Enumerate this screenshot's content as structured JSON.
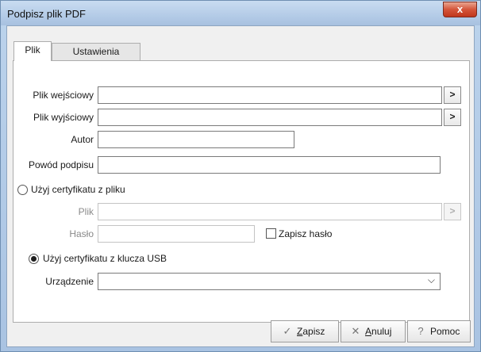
{
  "window": {
    "title": "Podpisz plik PDF",
    "close_symbol": "x"
  },
  "tabs": [
    {
      "label": "Plik",
      "active": true
    },
    {
      "label": "Ustawienia",
      "active": false
    }
  ],
  "form": {
    "input_file": {
      "label": "Plik wejściowy",
      "value": "",
      "browse": ">"
    },
    "output_file": {
      "label": "Plik wyjściowy",
      "value": "",
      "browse": ">"
    },
    "author": {
      "label": "Autor",
      "value": ""
    },
    "reason": {
      "label": "Powód podpisu",
      "value": ""
    },
    "cert_file_option": {
      "label": "Użyj certyfikatu z pliku",
      "selected": false
    },
    "cert_file": {
      "label": "Plik",
      "value": "",
      "browse": ">",
      "enabled": false
    },
    "password": {
      "label": "Hasło",
      "value": "",
      "enabled": false
    },
    "save_password": {
      "label": "Zapisz hasło",
      "checked": false
    },
    "usb_option": {
      "label": "Użyj certyfikatu z klucza USB",
      "selected": true
    },
    "device": {
      "label": "Urządzenie",
      "value": "",
      "arrow": "⌵"
    }
  },
  "buttons": {
    "save": {
      "accel": "Z",
      "rest": "apisz",
      "icon": "check-icon"
    },
    "cancel": {
      "accel": "A",
      "rest": "nuluj",
      "icon": "close-icon"
    },
    "help": {
      "label": "Pomoc",
      "icon": "help-icon"
    }
  }
}
